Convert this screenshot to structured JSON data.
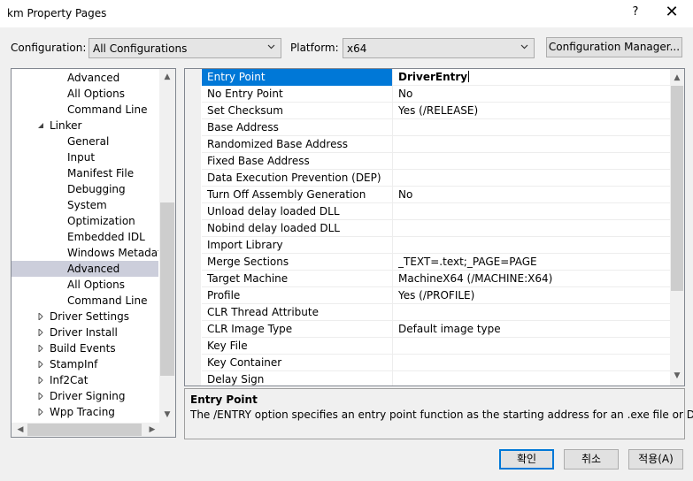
{
  "window": {
    "title": "km Property Pages",
    "help_glyph": "?",
    "close_glyph": "✕"
  },
  "toolbar": {
    "configuration_label": "Configuration:",
    "configuration_value": "All Configurations",
    "platform_label": "Platform:",
    "platform_value": "x64",
    "config_manager_label": "Configuration Manager..."
  },
  "tree": {
    "items": [
      {
        "label": "Advanced",
        "level": 2
      },
      {
        "label": "All Options",
        "level": 2
      },
      {
        "label": "Command Line",
        "level": 2
      },
      {
        "label": "Linker",
        "level": 1,
        "expanded": true
      },
      {
        "label": "General",
        "level": 2
      },
      {
        "label": "Input",
        "level": 2
      },
      {
        "label": "Manifest File",
        "level": 2
      },
      {
        "label": "Debugging",
        "level": 2
      },
      {
        "label": "System",
        "level": 2
      },
      {
        "label": "Optimization",
        "level": 2
      },
      {
        "label": "Embedded IDL",
        "level": 2
      },
      {
        "label": "Windows Metadata",
        "level": 2
      },
      {
        "label": "Advanced",
        "level": 2,
        "selected": true
      },
      {
        "label": "All Options",
        "level": 2
      },
      {
        "label": "Command Line",
        "level": 2
      },
      {
        "label": "Driver Settings",
        "level": 0,
        "collapsed": true
      },
      {
        "label": "Driver Install",
        "level": 0,
        "collapsed": true
      },
      {
        "label": "Build Events",
        "level": 0,
        "collapsed": true
      },
      {
        "label": "StampInf",
        "level": 0,
        "collapsed": true
      },
      {
        "label": "Inf2Cat",
        "level": 0,
        "collapsed": true
      },
      {
        "label": "Driver Signing",
        "level": 0,
        "collapsed": true
      },
      {
        "label": "Wpp Tracing",
        "level": 0,
        "collapsed": true
      }
    ]
  },
  "properties": [
    {
      "name": "Entry Point",
      "value": "DriverEntry",
      "selected": true
    },
    {
      "name": "No Entry Point",
      "value": "No"
    },
    {
      "name": "Set Checksum",
      "value": "Yes (/RELEASE)"
    },
    {
      "name": "Base Address",
      "value": ""
    },
    {
      "name": "Randomized Base Address",
      "value": ""
    },
    {
      "name": "Fixed Base Address",
      "value": ""
    },
    {
      "name": "Data Execution Prevention (DEP)",
      "value": ""
    },
    {
      "name": "Turn Off Assembly Generation",
      "value": "No"
    },
    {
      "name": "Unload delay loaded DLL",
      "value": ""
    },
    {
      "name": "Nobind delay loaded DLL",
      "value": ""
    },
    {
      "name": "Import Library",
      "value": ""
    },
    {
      "name": "Merge Sections",
      "value": "_TEXT=.text;_PAGE=PAGE"
    },
    {
      "name": "Target Machine",
      "value": "MachineX64 (/MACHINE:X64)"
    },
    {
      "name": "Profile",
      "value": "Yes (/PROFILE)"
    },
    {
      "name": "CLR Thread Attribute",
      "value": ""
    },
    {
      "name": "CLR Image Type",
      "value": "Default image type"
    },
    {
      "name": "Key File",
      "value": ""
    },
    {
      "name": "Key Container",
      "value": ""
    },
    {
      "name": "Delay Sign",
      "value": ""
    }
  ],
  "description": {
    "title": "Entry Point",
    "text": "The /ENTRY option specifies an entry point function as the starting address for an .exe file or DLL."
  },
  "buttons": {
    "ok": "확인",
    "cancel": "취소",
    "apply": "적용(A)"
  },
  "colors": {
    "selection": "#0078d7",
    "tree_selection": "#cccedb"
  }
}
